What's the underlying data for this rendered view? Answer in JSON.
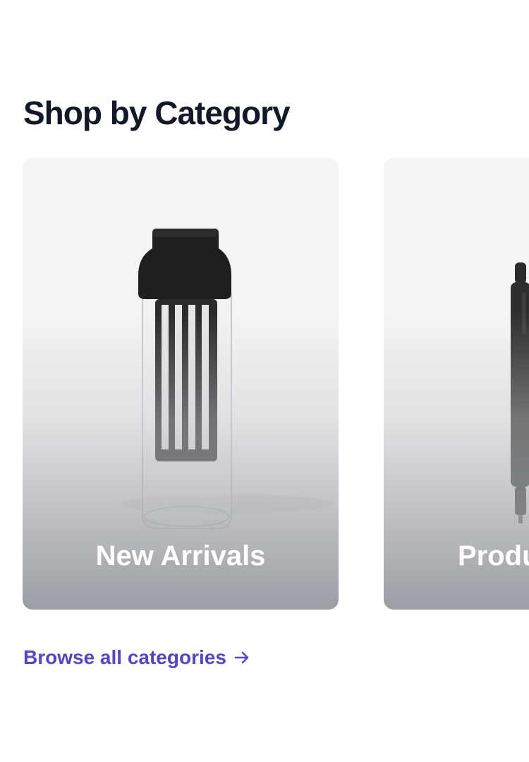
{
  "section": {
    "title": "Shop by Category"
  },
  "categories": [
    {
      "label": "New Arrivals",
      "icon": "carafe-image"
    },
    {
      "label": "Productivity",
      "icon": "pen-image"
    }
  ],
  "browse_link": {
    "label": "Browse all categories",
    "icon": "arrow-right-icon"
  },
  "colors": {
    "heading": "#111827",
    "link": "#5046c9",
    "card_bg": "#f4f4f4",
    "label": "#ffffff"
  }
}
